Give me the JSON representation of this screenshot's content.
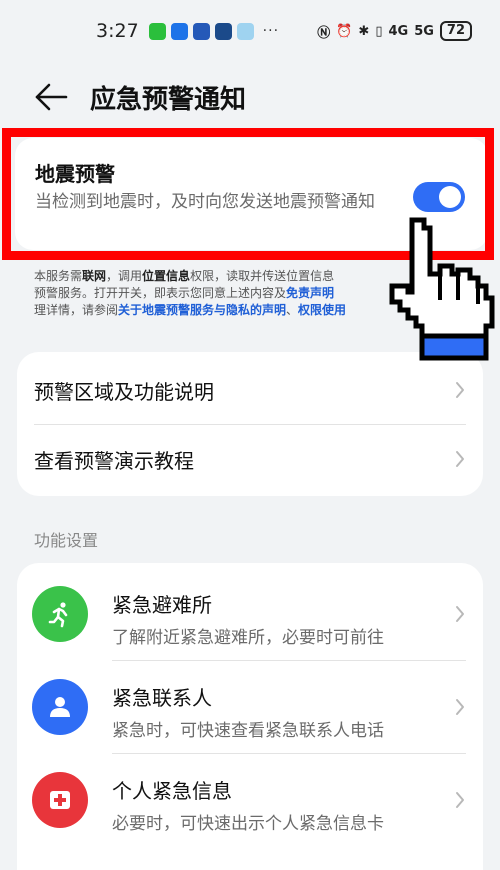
{
  "status_bar": {
    "time": "3:27",
    "dots": "···",
    "signal_text": "4G",
    "signal_text_2": "5G",
    "battery": "72"
  },
  "header": {
    "title": "应急预警通知"
  },
  "earthquake": {
    "title": "地震预警",
    "description": "当检测到地震时，及时向您发送地震预警通知",
    "toggle_on": true
  },
  "notice": {
    "t1": "本服务需",
    "b1": "联网",
    "t2": "，调用",
    "b2": "位置信息",
    "t3": "权限，读取并传送位置信息",
    "t4": "预警服务。打开开关，即表示您同意上述内容及",
    "l1": "免责声明",
    "t5": "理详情，请参阅",
    "l2": "关于地震预警服务与隐私的声明",
    "t6": "、",
    "l3": "权限使用"
  },
  "menu": {
    "item1": "预警区域及功能说明",
    "item2": "查看预警演示教程"
  },
  "section": {
    "title": "功能设置"
  },
  "features": [
    {
      "title": "紧急避难所",
      "subtitle": "了解附近紧急避难所，必要时可前往",
      "icon": "running-person-icon",
      "color": "#3ac24a"
    },
    {
      "title": "紧急联系人",
      "subtitle": "紧急时，可快速查看紧急联系人电话",
      "icon": "contact-person-icon",
      "color": "#2f6df5"
    },
    {
      "title": "个人紧急信息",
      "subtitle": "必要时，可快速出示个人紧急信息卡",
      "icon": "medical-cross-icon",
      "color": "#e8353b"
    }
  ],
  "colors": {
    "accent": "#2f6df5",
    "highlight_frame": "#ff0000",
    "link": "#1f5fd6"
  }
}
